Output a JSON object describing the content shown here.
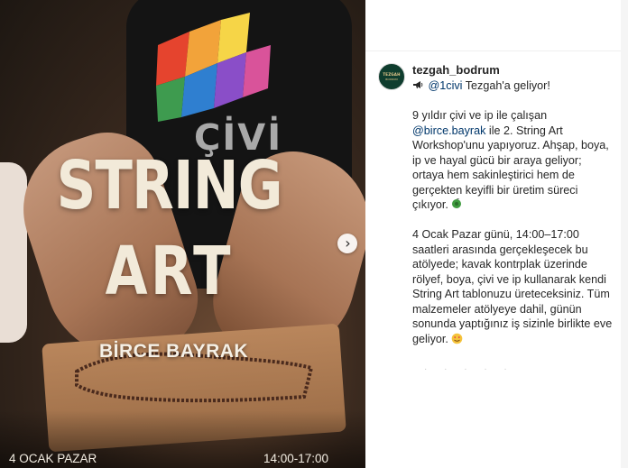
{
  "poster": {
    "title_line1": "STRING",
    "title_line2": "ART",
    "author": "BİRCE BAYRAK",
    "date": "4 OCAK PAZAR",
    "time": "14:00-17:00",
    "shirt_text": "ÇİVİ",
    "next_icon": "chevron-right-icon"
  },
  "post": {
    "username": "tezgah_bodrum",
    "avatar_text": "TEZGAH",
    "avatar_subtext": "BODRUM",
    "intro_icon": "megaphone-icon",
    "intro_mention": "@1civi",
    "intro_text": " Tezgah'a geliyor!",
    "p2_before": "9 yıldır çivi ve ip ile çalışan ",
    "p2_mention": "@birce.bayrak",
    "p2_after": " ile 2. String Art Workshop'unu yapıyoruz. Ahşap, boya, ip ve hayal gücü bir araya geliyor; ortaya hem sakinleştirici hem de gerçekten keyifli bir üretim süreci çıkıyor.",
    "p2_emoji": "🪀",
    "p3_text": "4 Ocak Pazar günü, 14:00–17:00 saatleri arasında gerçekleşecek bu atölyede; kavak kontrplak üzerinde rölyef, boya, çivi ve ip kullanarak kendi String Art tablonuzu üreteceksiniz. Tüm malzemeler atölyeye dahil, günün sonunda yaptığınız iş sizinle birlikte eve geliyor.",
    "p3_emoji": "🥰"
  },
  "colors": {
    "mention": "#00376b",
    "text": "#262626",
    "poster_text": "#f2ead9"
  }
}
